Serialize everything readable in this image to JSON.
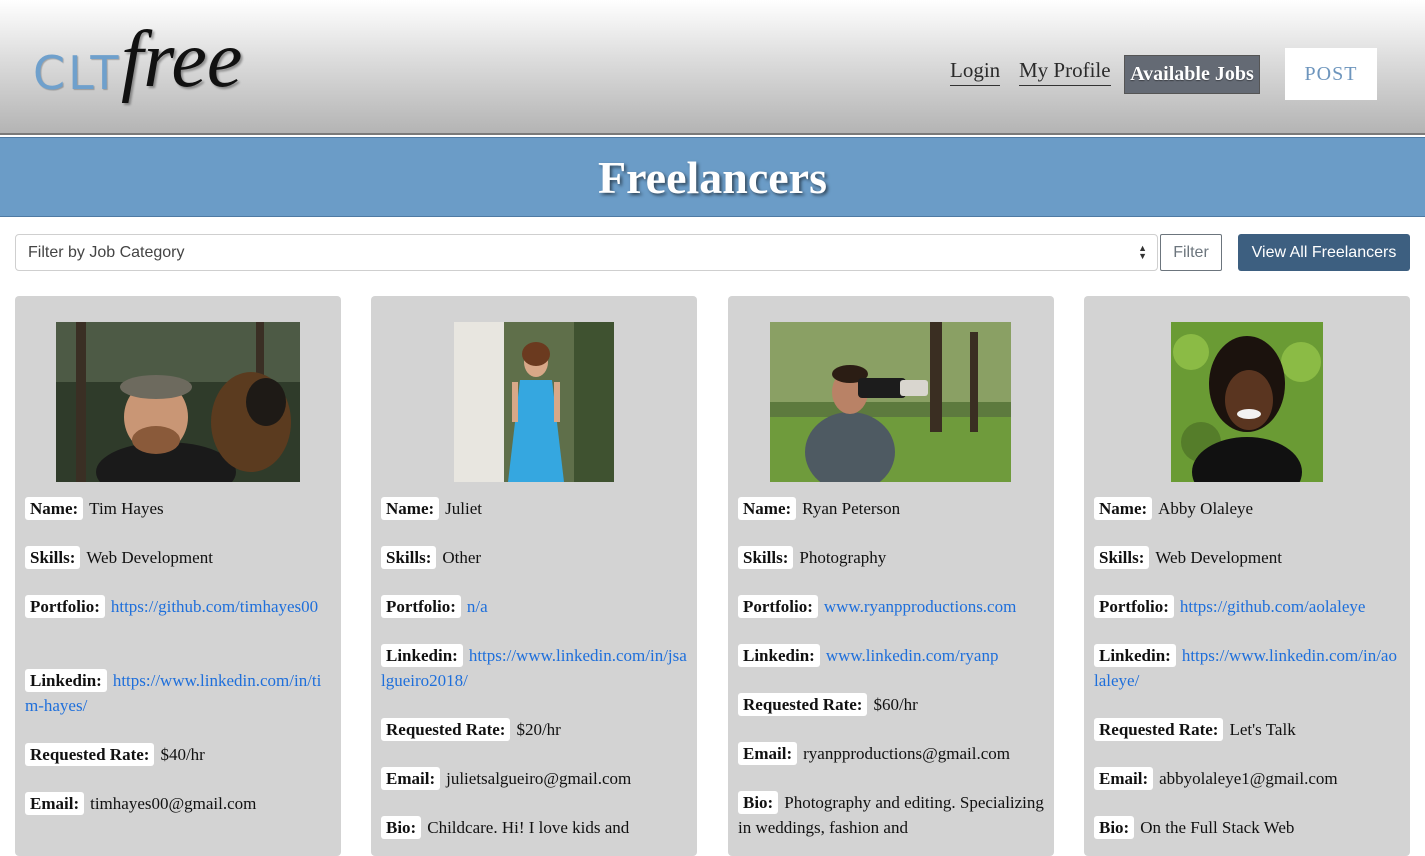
{
  "header": {
    "logo_clt": "CLT",
    "logo_free": "free",
    "nav": {
      "login": "Login",
      "my_profile": "My Profile",
      "available_jobs": "Available Jobs",
      "post": "POST"
    }
  },
  "banner": {
    "title": "Freelancers"
  },
  "filter": {
    "select_value": "Filter by Job Category",
    "filter_button": "Filter",
    "view_all_button": "View All Freelancers"
  },
  "labels": {
    "name": "Name:",
    "skills": "Skills:",
    "portfolio": "Portfolio:",
    "linkedin": "Linkedin:",
    "rate": "Requested Rate:",
    "email": "Email:",
    "bio": "Bio:"
  },
  "freelancers": [
    {
      "name": "Tim Hayes",
      "skills": "Web Development",
      "portfolio": "https://github.com/timhayes00",
      "linkedin": "https://www.linkedin.com/in/tim-hayes/",
      "rate": "$40/hr",
      "email": "timhayes00@gmail.com",
      "bio": ""
    },
    {
      "name": "Juliet",
      "skills": "Other",
      "portfolio": "n/a",
      "linkedin": "https://www.linkedin.com/in/jsalgueiro2018/",
      "rate": "$20/hr",
      "email": "julietsalgueiro@gmail.com",
      "bio": "Childcare. Hi! I love kids and"
    },
    {
      "name": "Ryan Peterson",
      "skills": "Photography",
      "portfolio": "www.ryanpproductions.com",
      "linkedin": "www.linkedin.com/ryanp",
      "rate": "$60/hr",
      "email": "ryanpproductions@gmail.com",
      "bio": "Photography and editing. Specializing in weddings, fashion and"
    },
    {
      "name": "Abby Olaleye",
      "skills": "Web Development",
      "portfolio": "https://github.com/aolaleye",
      "linkedin": "https://www.linkedin.com/in/aolaleye/",
      "rate": "Let's Talk",
      "email": "abbyolaleye1@gmail.com",
      "bio": "On the Full Stack Web"
    }
  ],
  "colors": {
    "banner": "#6b9cc7",
    "card": "#d3d3d3",
    "link": "#1e6fdb",
    "view_all": "#3d5f80",
    "jobs_button": "#646a74"
  }
}
